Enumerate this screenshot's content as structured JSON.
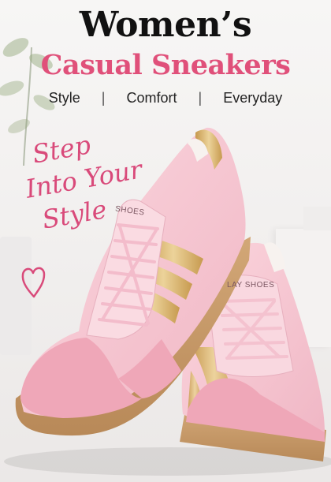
{
  "headline": {
    "title": "Women’s",
    "subtitle": "Casual Sneakers"
  },
  "tags": [
    "Style",
    "Comfort",
    "Everyday"
  ],
  "tag_separator": "|",
  "slogan": [
    "Step",
    "Into Your",
    "Style"
  ],
  "brand": {
    "left_shoe_label": "SHOES",
    "right_shoe_label": "LAY SHOES"
  },
  "colors": {
    "accent_pink": "#e0507a",
    "shoe_pink": "#f6c6d1",
    "suede_pink": "#eea6b7",
    "gold_stripe": "#d8b26a",
    "gum_sole": "#c79b6a"
  }
}
